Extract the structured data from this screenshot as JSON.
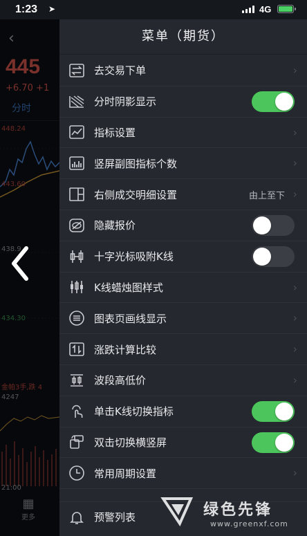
{
  "status_bar": {
    "time": "1:23",
    "network": "4G"
  },
  "background": {
    "price": "445",
    "change": "+6.70 +1",
    "tab": "分时",
    "levels": [
      "448.24",
      "443.60",
      "438.9",
      "434.30"
    ],
    "volume_label": "金帕3手,跌 4",
    "volume_value": "4247",
    "time_label": "21:00",
    "more_label": "更多"
  },
  "drawer": {
    "title": "菜单（期货）",
    "items": [
      {
        "label": "去交易下单",
        "icon": "transfer-icon",
        "type": "link"
      },
      {
        "label": "分时阴影显示",
        "icon": "shade-area-icon",
        "type": "toggle",
        "on": true
      },
      {
        "label": "指标设置",
        "icon": "indicator-chart-icon",
        "type": "link"
      },
      {
        "label": "竖屏副图指标个数",
        "icon": "bar-chart-icon",
        "type": "link"
      },
      {
        "label": "右侧成交明细设置",
        "icon": "split-panel-icon",
        "type": "select",
        "value": "由上至下"
      },
      {
        "label": "隐藏报价",
        "icon": "eye-hidden-icon",
        "type": "toggle",
        "on": false
      },
      {
        "label": "十字光标吸附K线",
        "icon": "crosshair-candle-icon",
        "type": "toggle",
        "on": false
      },
      {
        "label": "K线蜡烛图样式",
        "icon": "candlestick-icon",
        "type": "link"
      },
      {
        "label": "图表页画线显示",
        "icon": "draw-lines-icon",
        "type": "link"
      },
      {
        "label": "涨跌计算比较",
        "icon": "up-down-compare-icon",
        "type": "link"
      },
      {
        "label": "波段高低价",
        "icon": "band-high-low-icon",
        "type": "link"
      },
      {
        "label": "单击K线切换指标",
        "icon": "tap-finger-icon",
        "type": "toggle",
        "on": true
      },
      {
        "label": "双击切换横竖屏",
        "icon": "rotate-screen-icon",
        "type": "toggle",
        "on": true
      },
      {
        "label": "常用周期设置",
        "icon": "clock-icon",
        "type": "link"
      }
    ],
    "last_item": {
      "label": "预警列表",
      "icon": "bell-alert-icon"
    }
  },
  "watermark": {
    "text": "绿色先锋",
    "url": "www.greenxf.com"
  }
}
